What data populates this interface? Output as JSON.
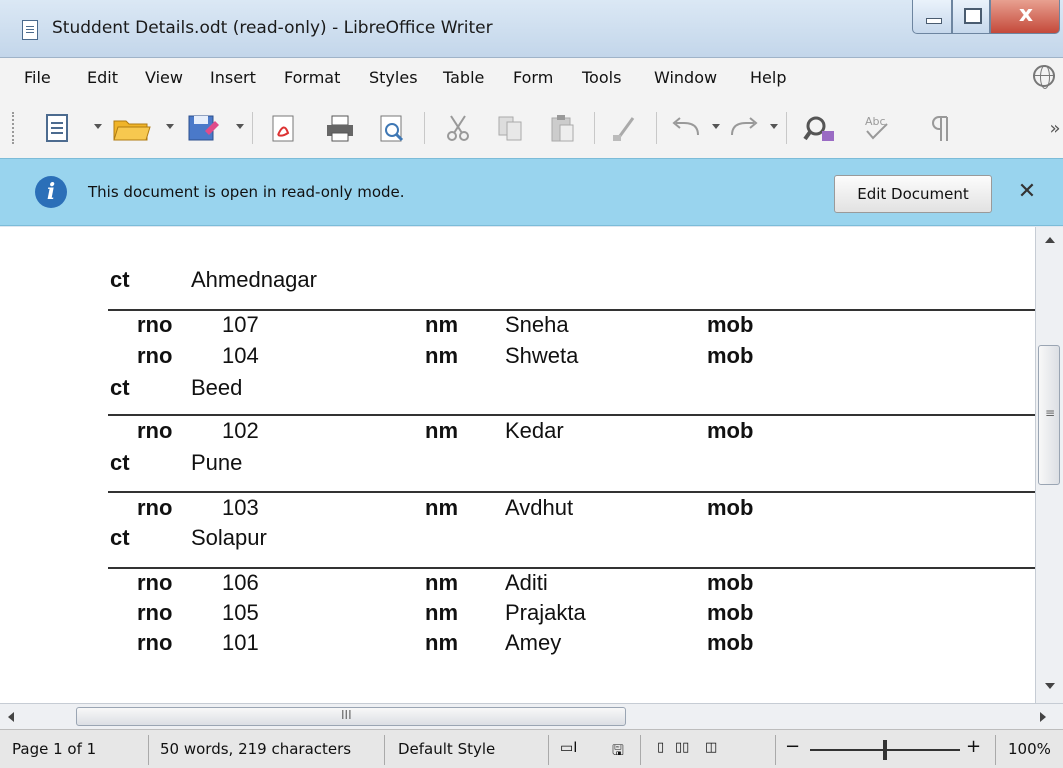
{
  "window": {
    "title": "Studdent Details.odt (read-only) - LibreOffice Writer",
    "close_glyph": "x"
  },
  "menu": [
    "File",
    "Edit",
    "View",
    "Insert",
    "Format",
    "Styles",
    "Table",
    "Form",
    "Tools",
    "Window",
    "Help"
  ],
  "toolbar": {
    "icons": [
      "new-document-icon",
      "open-folder-icon",
      "save-icon",
      "export-pdf-icon",
      "print-icon",
      "print-preview-icon",
      "cut-icon",
      "copy-icon",
      "paste-icon",
      "clone-formatting-icon",
      "undo-icon",
      "redo-icon",
      "find-replace-icon",
      "spelling-icon",
      "formatting-marks-icon"
    ],
    "overflow": "»"
  },
  "infobar": {
    "message": "This document is open in read-only mode.",
    "edit_button": "Edit Document",
    "close": "✕"
  },
  "document": {
    "groups": [
      {
        "ct_label": "ct",
        "city": "Ahmednagar",
        "rows": [
          {
            "rno_label": "rno",
            "rno": "107",
            "nm_label": "nm",
            "name": "Sneha",
            "mob_label": "mob"
          },
          {
            "rno_label": "rno",
            "rno": "104",
            "nm_label": "nm",
            "name": "Shweta",
            "mob_label": "mob"
          }
        ]
      },
      {
        "ct_label": "ct",
        "city": "Beed",
        "rows": [
          {
            "rno_label": "rno",
            "rno": "102",
            "nm_label": "nm",
            "name": "Kedar",
            "mob_label": "mob"
          }
        ]
      },
      {
        "ct_label": "ct",
        "city": "Pune",
        "rows": [
          {
            "rno_label": "rno",
            "rno": "103",
            "nm_label": "nm",
            "name": "Avdhut",
            "mob_label": "mob"
          }
        ]
      },
      {
        "ct_label": "ct",
        "city": "Solapur",
        "rows": [
          {
            "rno_label": "rno",
            "rno": "106",
            "nm_label": "nm",
            "name": "Aditi",
            "mob_label": "mob"
          },
          {
            "rno_label": "rno",
            "rno": "105",
            "nm_label": "nm",
            "name": "Prajakta",
            "mob_label": "mob"
          },
          {
            "rno_label": "rno",
            "rno": "101",
            "nm_label": "nm",
            "name": "Amey",
            "mob_label": "mob"
          }
        ]
      }
    ]
  },
  "scrollbar": {
    "grip": "≡",
    "hgrip": "III"
  },
  "status": {
    "page": "Page 1 of 1",
    "words": "50 words, 219 characters",
    "style": "Default Style",
    "zoom": "100%",
    "zoom_minus": "−",
    "zoom_plus": "+"
  },
  "colors": {
    "infobar": "#99d4ee",
    "info_icon": "#2b6fb8",
    "close_button": "#c4493a"
  }
}
